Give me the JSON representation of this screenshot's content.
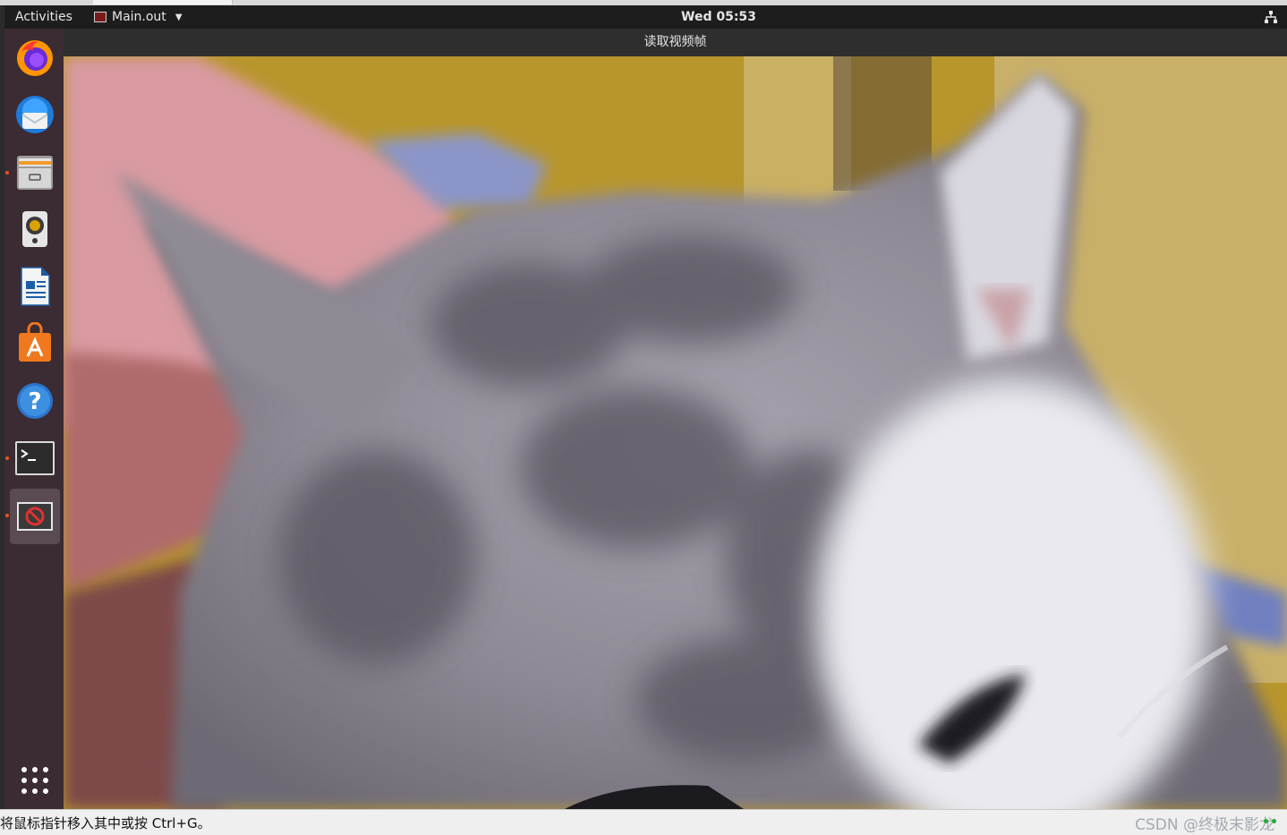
{
  "topbar": {
    "activities": "Activities",
    "app_menu": "Main.out",
    "clock": "Wed 05:53"
  },
  "dock": {
    "items": [
      {
        "name": "firefox"
      },
      {
        "name": "thunderbird"
      },
      {
        "name": "files",
        "running": true
      },
      {
        "name": "rhythmbox"
      },
      {
        "name": "libreoffice-writer"
      },
      {
        "name": "ubuntu-software"
      },
      {
        "name": "help"
      },
      {
        "name": "terminal",
        "running": true
      },
      {
        "name": "main-out",
        "running": true,
        "active": true
      }
    ],
    "show_apps": "show-applications"
  },
  "window": {
    "title": "读取视频帧"
  },
  "statusbar": {
    "hint": "将鼠标指针移入其中或按 Ctrl+G。",
    "watermark": "CSDN @终极末影龙"
  },
  "colors": {
    "topbar_bg": "#1d1d1d",
    "dock_bg": "#3b2b33",
    "accent": "#e95420"
  }
}
